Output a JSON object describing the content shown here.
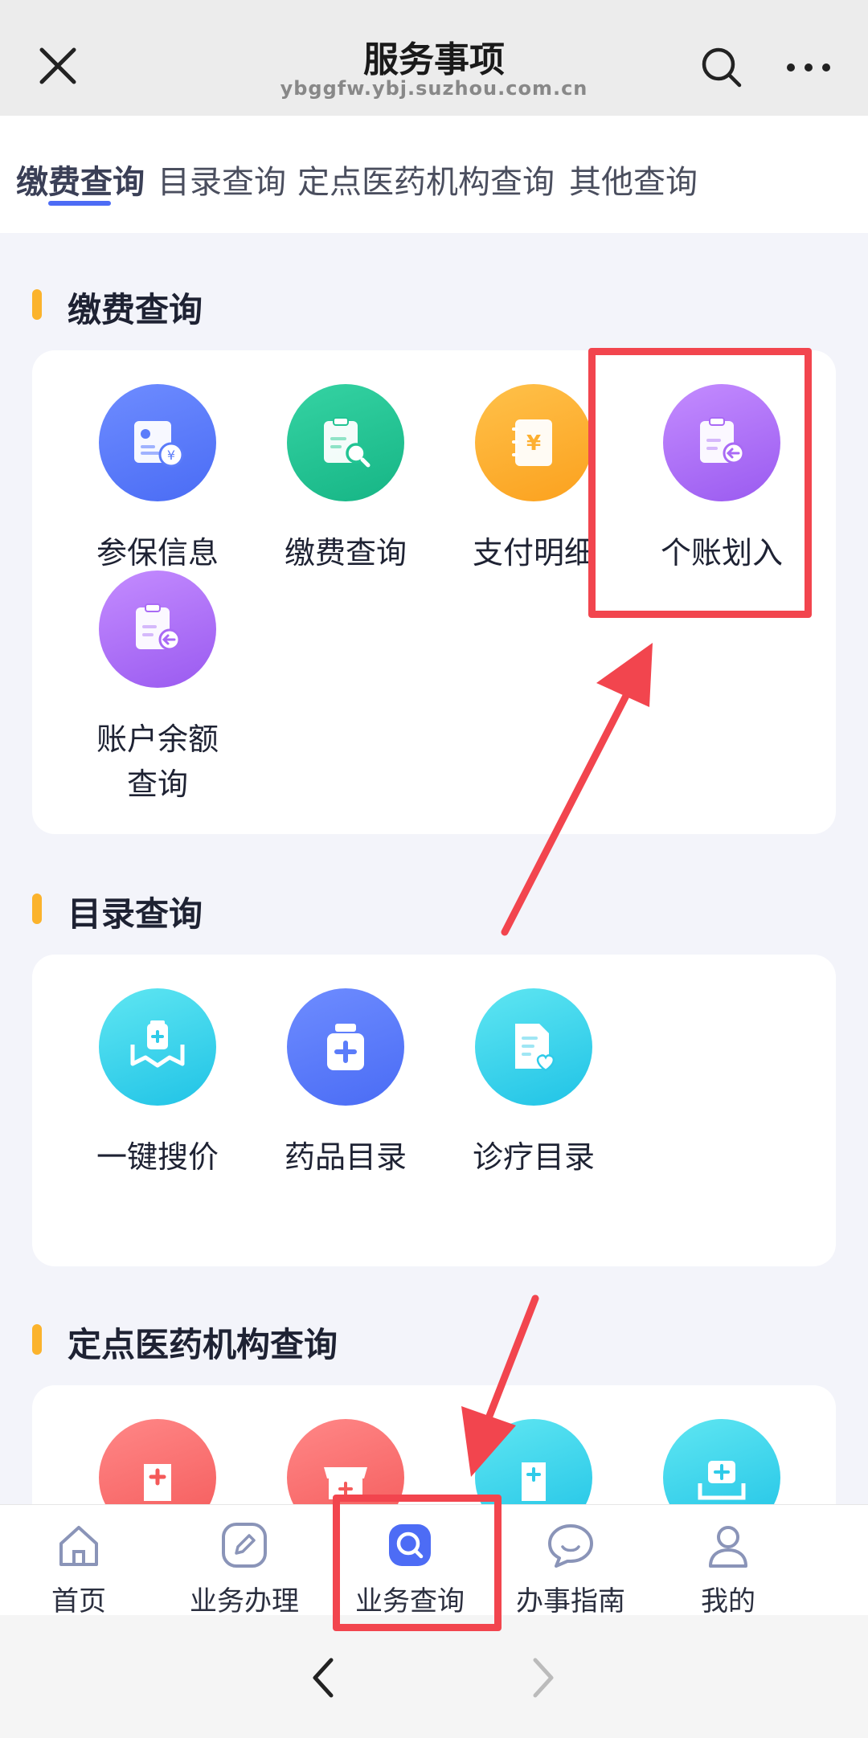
{
  "header": {
    "title": "服务事项",
    "url": "ybggfw.ybj.suzhou.com.cn"
  },
  "tabs": [
    {
      "label": "缴费查询",
      "active": true
    },
    {
      "label": "目录查询",
      "active": false
    },
    {
      "label": "定点医药机构查询",
      "active": false
    },
    {
      "label": "其他查询",
      "active": false
    }
  ],
  "sections": {
    "payment": {
      "title": "缴费查询",
      "items": [
        {
          "label": "参保信息",
          "icon": "insurance-info-icon",
          "color": "#5b7cfa"
        },
        {
          "label": "缴费查询",
          "icon": "payment-search-icon",
          "color": "#22c493"
        },
        {
          "label": "支付明细",
          "icon": "payment-detail-icon",
          "color": "#fdaf30"
        },
        {
          "label": "个账划入",
          "icon": "account-transfer-icon",
          "color": "#a96af5"
        },
        {
          "label_line1": "账户余额",
          "label_line2": "查询",
          "icon": "account-balance-icon",
          "color": "#a96af5"
        }
      ]
    },
    "catalog": {
      "title": "目录查询",
      "items": [
        {
          "label": "一键搜价",
          "icon": "price-search-icon",
          "color": "#2fcbe9"
        },
        {
          "label": "药品目录",
          "icon": "medicine-catalog-icon",
          "color": "#5b7cfa"
        },
        {
          "label": "诊疗目录",
          "icon": "treatment-catalog-icon",
          "color": "#2fcbe9"
        }
      ]
    },
    "institutions": {
      "title": "定点医药机构查询"
    }
  },
  "bottom_nav": [
    {
      "label": "首页",
      "icon": "home-icon"
    },
    {
      "label": "业务办理",
      "icon": "edit-icon"
    },
    {
      "label": "业务查询",
      "icon": "search-icon",
      "active": true
    },
    {
      "label": "办事指南",
      "icon": "chat-icon"
    },
    {
      "label": "我的",
      "icon": "user-icon"
    }
  ],
  "colors": {
    "accent": "#4d6cf5",
    "section_bar": "#fbb32c",
    "annotation": "#f2454e"
  }
}
